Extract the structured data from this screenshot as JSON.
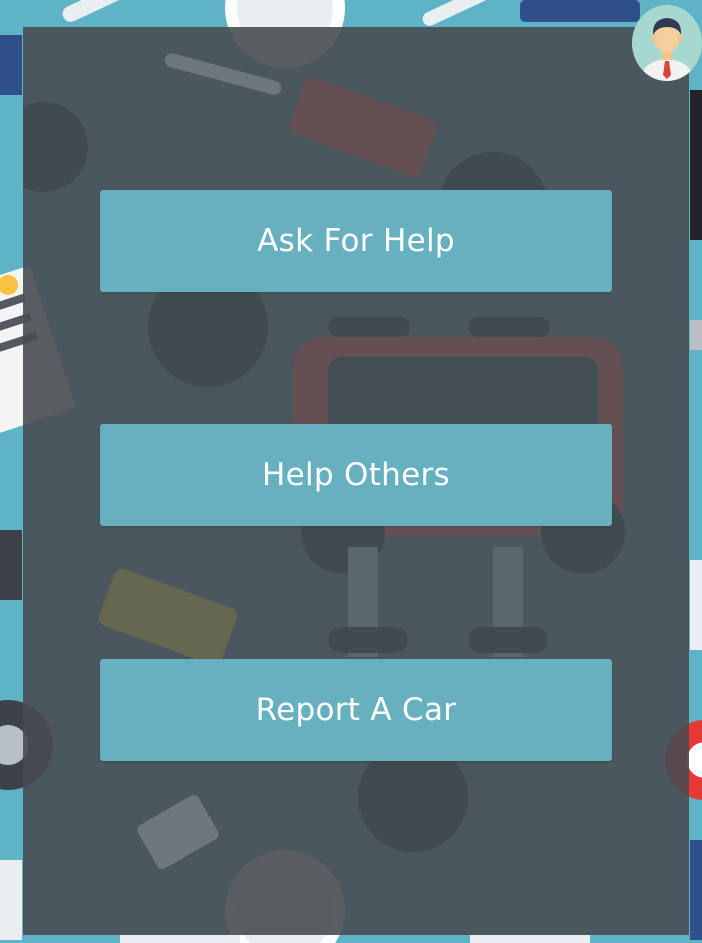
{
  "theme": {
    "background": "#5fb3c6",
    "panel": "#484c52",
    "button": "#66b0c0",
    "button_text": "#ffffff"
  },
  "profile": {
    "icon": "user-avatar-icon"
  },
  "menu": {
    "buttons": [
      {
        "label": "Ask For Help"
      },
      {
        "label": "Help Others"
      },
      {
        "label": "Report A Car"
      }
    ]
  }
}
